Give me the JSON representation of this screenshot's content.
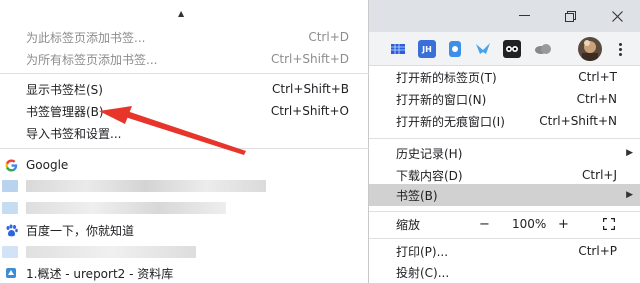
{
  "bookmarks_menu": {
    "items": [
      {
        "label": "为此标签页添加书签...",
        "shortcut": "Ctrl+D"
      },
      {
        "label": "为所有标签页添加书签...",
        "shortcut": "Ctrl+Shift+D"
      },
      {
        "label": "显示书签栏(S)",
        "shortcut": "Ctrl+Shift+B"
      },
      {
        "label": "书签管理器(B)",
        "shortcut": "Ctrl+Shift+O"
      },
      {
        "label": "导入书签和设置..."
      }
    ],
    "bookmarks": [
      {
        "label": "Google",
        "icon": "google-icon"
      },
      {
        "label": "百度一下，你就知道",
        "icon": "baidu-paw-icon"
      },
      {
        "label": "1.概述 - ureport2 - 资料库",
        "icon": "ureport-icon"
      }
    ]
  },
  "toolbar": {
    "extensions": [
      {
        "icon": "grid-extension-icon",
        "text": "",
        "color": "#2b5fd9"
      },
      {
        "icon": "jh-extension-icon",
        "text": "JH",
        "color": "#3a6fd8"
      },
      {
        "icon": "tag-extension-icon",
        "text": "",
        "color": "#3d8fe8"
      },
      {
        "icon": "bird-extension-icon",
        "text": "",
        "color": "#4aa3e8"
      },
      {
        "icon": "eyes-extension-icon",
        "text": "",
        "color": "#222222"
      },
      {
        "icon": "cloud-extension-icon",
        "text": "",
        "color": "#888888"
      }
    ]
  },
  "main_menu": {
    "items": [
      {
        "label": "打开新的标签页(T)",
        "shortcut": "Ctrl+T"
      },
      {
        "label": "打开新的窗口(N)",
        "shortcut": "Ctrl+N"
      },
      {
        "label": "打开新的无痕窗口(I)",
        "shortcut": "Ctrl+Shift+N"
      },
      {
        "label": "历史记录(H)",
        "shortcut": ""
      },
      {
        "label": "下载内容(D)",
        "shortcut": "Ctrl+J"
      },
      {
        "label": "书签(B)",
        "shortcut": ""
      },
      {
        "label": "打印(P)...",
        "shortcut": "Ctrl+P"
      },
      {
        "label": "投射(C)...",
        "shortcut": ""
      }
    ],
    "zoom": {
      "label": "缩放",
      "minus": "−",
      "value": "100%",
      "plus": "+"
    }
  },
  "colors": {
    "arrow": "#e8352b",
    "highlight": "#d1d1d1"
  }
}
